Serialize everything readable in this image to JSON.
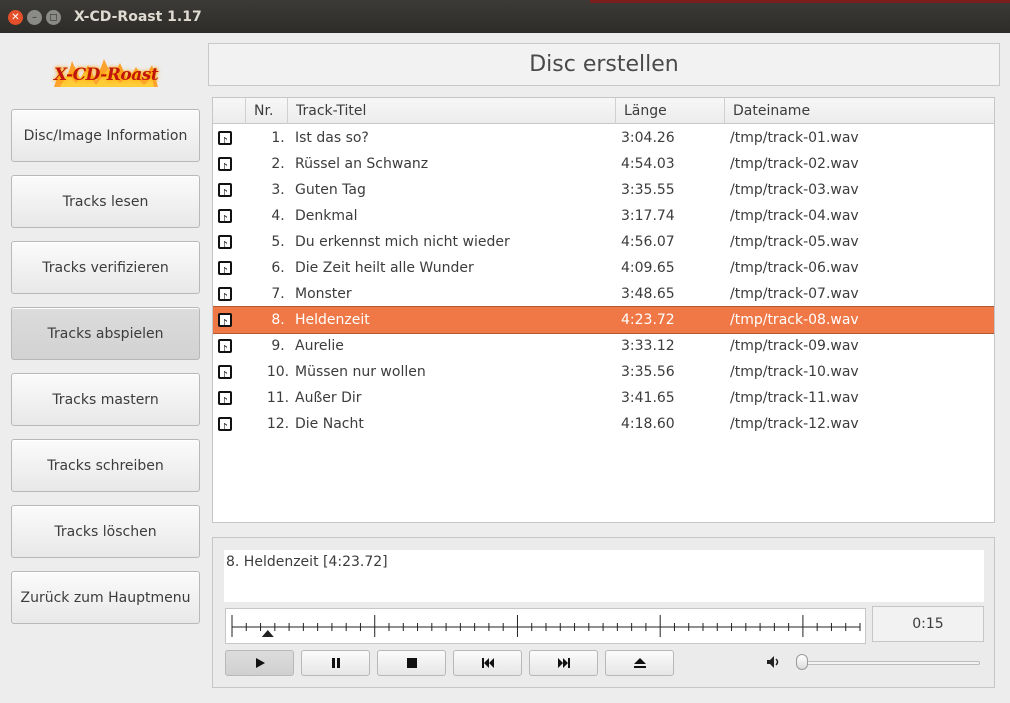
{
  "window": {
    "title": "X-CD-Roast 1.17",
    "close_glyph": "✕",
    "minimize_glyph": "–",
    "maximize_glyph": "◻"
  },
  "logo": {
    "text": "X-CD-Roast"
  },
  "sidebar": {
    "items": [
      {
        "label": "Disc/Image Information"
      },
      {
        "label": "Tracks lesen"
      },
      {
        "label": "Tracks verifizieren"
      },
      {
        "label": "Tracks abspielen",
        "active": true
      },
      {
        "label": "Tracks mastern"
      },
      {
        "label": "Tracks schreiben"
      },
      {
        "label": "Tracks löschen"
      },
      {
        "label": "Zurück zum Hauptmenu"
      }
    ]
  },
  "heading": "Disc erstellen",
  "table": {
    "columns": {
      "nr": "Nr.",
      "title": "Track-Titel",
      "length": "Länge",
      "file": "Dateiname"
    },
    "rows": [
      {
        "nr": "1.",
        "title": "Ist das so?",
        "length": "3:04.26",
        "file": "/tmp/track-01.wav"
      },
      {
        "nr": "2.",
        "title": "Rüssel an Schwanz",
        "length": "4:54.03",
        "file": "/tmp/track-02.wav"
      },
      {
        "nr": "3.",
        "title": "Guten Tag",
        "length": "3:35.55",
        "file": "/tmp/track-03.wav"
      },
      {
        "nr": "4.",
        "title": "Denkmal",
        "length": "3:17.74",
        "file": "/tmp/track-04.wav"
      },
      {
        "nr": "5.",
        "title": "Du erkennst mich nicht wieder",
        "length": "4:56.07",
        "file": "/tmp/track-05.wav"
      },
      {
        "nr": "6.",
        "title": "Die Zeit heilt alle Wunder",
        "length": "4:09.65",
        "file": "/tmp/track-06.wav"
      },
      {
        "nr": "7.",
        "title": "Monster",
        "length": "3:48.65",
        "file": "/tmp/track-07.wav"
      },
      {
        "nr": "8.",
        "title": "Heldenzeit",
        "length": "4:23.72",
        "file": "/tmp/track-08.wav",
        "selected": true
      },
      {
        "nr": "9.",
        "title": "Aurelie",
        "length": "3:33.12",
        "file": "/tmp/track-09.wav"
      },
      {
        "nr": "10.",
        "title": "Müssen nur wollen",
        "length": "3:35.56",
        "file": "/tmp/track-10.wav"
      },
      {
        "nr": "11.",
        "title": "Außer Dir",
        "length": "3:41.65",
        "file": "/tmp/track-11.wav"
      },
      {
        "nr": "12.",
        "title": "Die Nacht",
        "length": "4:18.60",
        "file": "/tmp/track-12.wav"
      }
    ],
    "row_icon": "music-file-icon"
  },
  "player": {
    "now_playing": "8. Heldenzeit [4:23.72]",
    "elapsed": "0:15",
    "position_fraction": 0.057,
    "volume_fraction": 0.0,
    "buttons": [
      "play-icon",
      "pause-icon",
      "stop-icon",
      "previous-icon",
      "next-icon",
      "eject-icon"
    ]
  },
  "colors": {
    "selection": "#f07746",
    "titlebar": "#3c3b37",
    "close_button": "#e3502b"
  }
}
